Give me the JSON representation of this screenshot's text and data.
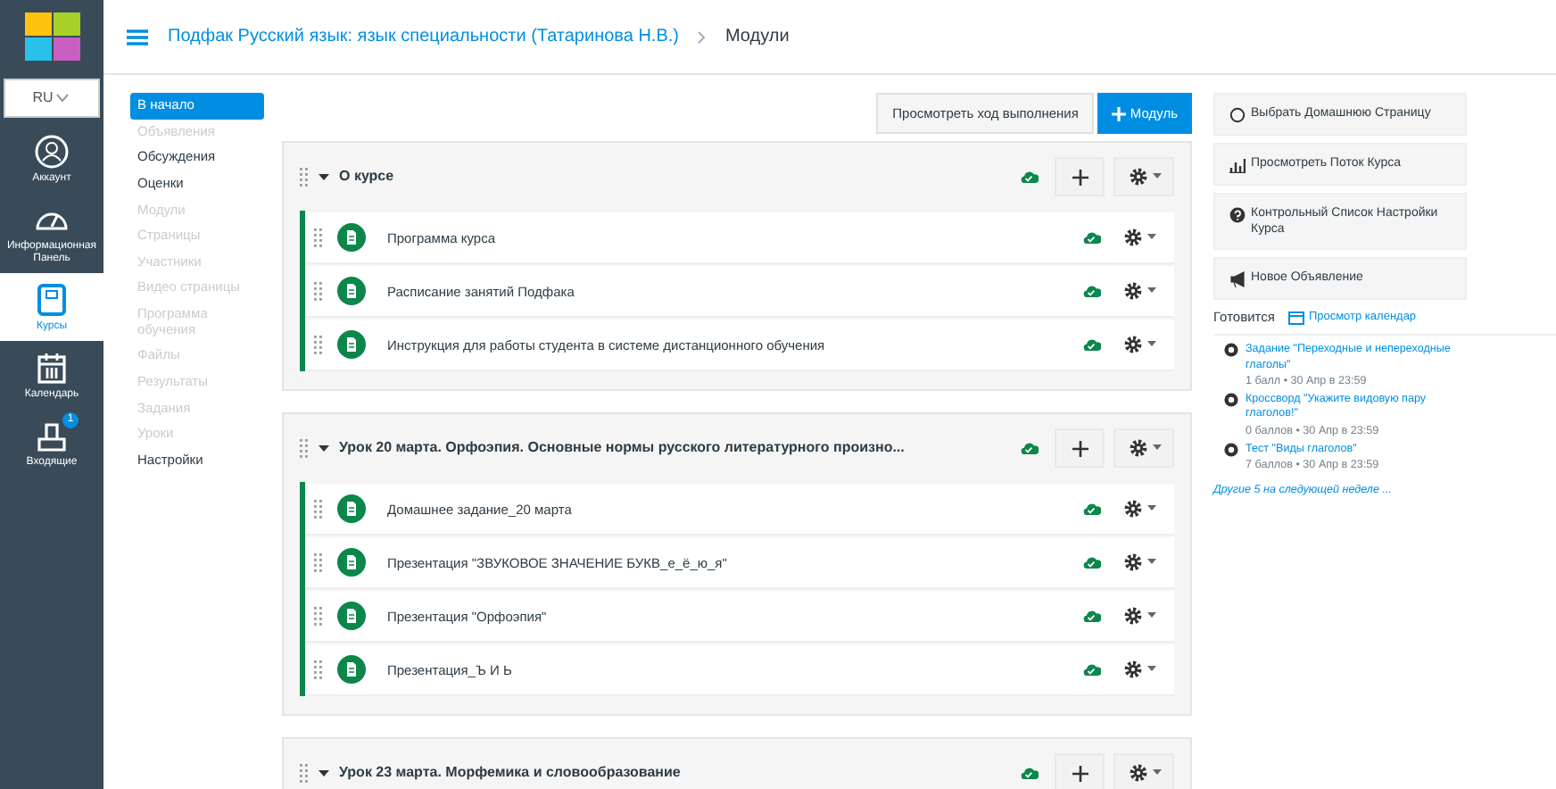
{
  "global_nav": {
    "language": "RU",
    "items": [
      {
        "label": "Аккаунт",
        "kind": "account",
        "selected": false
      },
      {
        "label": "Информационная Панель",
        "kind": "dashboard",
        "selected": false
      },
      {
        "label": "Курсы",
        "kind": "courses",
        "selected": true
      },
      {
        "label": "Календарь",
        "kind": "calendar",
        "selected": false
      },
      {
        "label": "Входящие",
        "kind": "inbox",
        "selected": false,
        "badge": "1"
      }
    ]
  },
  "breadcrumb": [
    {
      "text": "Подфак Русский язык: язык специальности (Татаринова Н.В.)",
      "kind": "link"
    },
    {
      "text": "Модули",
      "kind": "current"
    }
  ],
  "course_nav": [
    {
      "label": "В начало",
      "selected": true,
      "disabled": false
    },
    {
      "label": "Объявления",
      "selected": false,
      "disabled": true
    },
    {
      "label": "Обсуждения",
      "selected": false,
      "disabled": false
    },
    {
      "label": "Оценки",
      "selected": false,
      "disabled": false
    },
    {
      "label": "Модули",
      "selected": false,
      "disabled": true
    },
    {
      "label": "Страницы",
      "selected": false,
      "disabled": true
    },
    {
      "label": "Участники",
      "selected": false,
      "disabled": true
    },
    {
      "label": "Видео страницы",
      "selected": false,
      "disabled": true
    },
    {
      "label": "Программа обучения",
      "selected": false,
      "disabled": true
    },
    {
      "label": "Файлы",
      "selected": false,
      "disabled": true
    },
    {
      "label": "Результаты",
      "selected": false,
      "disabled": true
    },
    {
      "label": "Задания",
      "selected": false,
      "disabled": true
    },
    {
      "label": "Уроки",
      "selected": false,
      "disabled": true
    },
    {
      "label": "Настройки",
      "selected": false,
      "disabled": false
    }
  ],
  "toolbar": {
    "progress_button": "Просмотреть ход выполнения",
    "module_button": "Модуль"
  },
  "modules": [
    {
      "title": "О курсе",
      "expanded": true,
      "items": [
        {
          "title": "Программа курса"
        },
        {
          "title": "Расписание занятий Подфака"
        },
        {
          "title": "Инструкция для работы студента в системе дистанционного обучения"
        }
      ]
    },
    {
      "title": "Урок 20 марта. Орфоэпия. Основные нормы русского литературного произно...",
      "expanded": true,
      "items": [
        {
          "title": "Домашнее задание_20 марта"
        },
        {
          "title": "Презентация \"ЗВУКОВОЕ ЗНАЧЕНИЕ БУКВ_е_ё_ю_я\""
        },
        {
          "title": "Презентация \"Орфоэпия\""
        },
        {
          "title": "Презентация_Ъ И Ь"
        }
      ]
    },
    {
      "title": "Урок 23 марта. Морфемика и словообразование",
      "expanded": true
    }
  ],
  "actions": [
    {
      "label": "Выбрать Домашнюю Страницу",
      "kind": "homepage"
    },
    {
      "label": "Просмотреть Поток Курса",
      "kind": "stream"
    },
    {
      "label": "Контрольный Список Настройки Курса",
      "kind": "checklist"
    },
    {
      "label": "Новое Объявление",
      "kind": "announcement"
    }
  ],
  "todo": {
    "heading": "Готовится",
    "calendar_link": "Просмотр календар",
    "items": [
      {
        "title": "Задание \"Переходные и непереходные глаголы\"",
        "details": "1 балл • 30 Апр в 23:59"
      },
      {
        "title": "Кроссворд \"Укажите видовую пару глаголов!\"",
        "details": "0 баллов • 30 Апр в 23:59"
      },
      {
        "title": "Тест \"Виды глаголов\"",
        "details": "7 баллов • 30 Апр в 23:59"
      }
    ],
    "more": "Другие 5 на следующей неделе ..."
  }
}
